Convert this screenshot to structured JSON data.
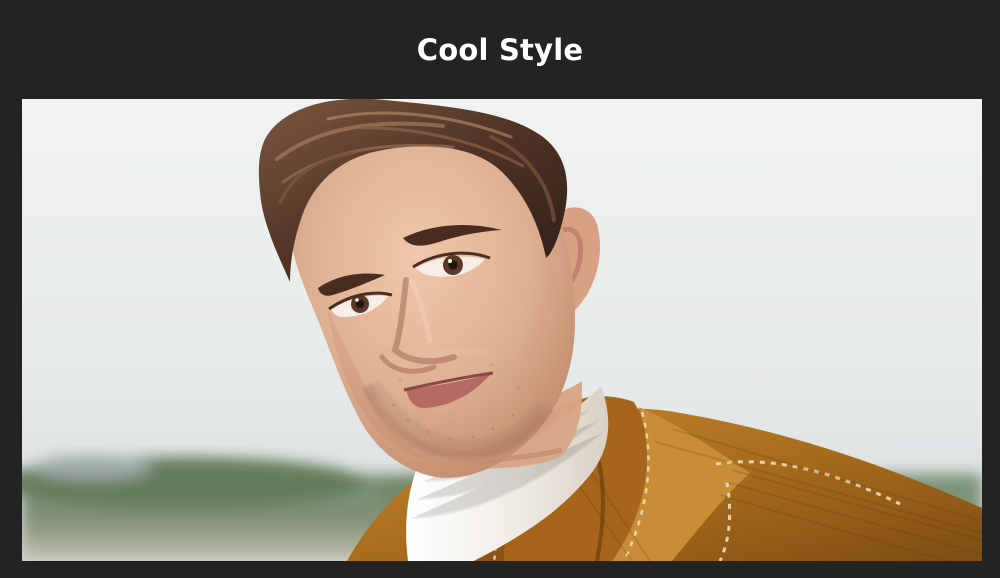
{
  "page": {
    "title": "Cool Style",
    "background_color": "#232323",
    "title_color": "#ffffff"
  },
  "photo": {
    "subject": "portrait-photo",
    "palette": {
      "sky": "#e9ecec",
      "sky_shadow": "#d7dcdd",
      "horizon_green": "#667a5a",
      "ground": "#b7bba7",
      "skin": "#e2b79a",
      "skin_shadow": "#c68f72",
      "hair": "#5a3b2a",
      "hair_highlight": "#8a634a",
      "sweater": "#ece8df",
      "jacket": "#b3761f",
      "jacket_shadow": "#8d5714",
      "stitch": "#f2d7b3"
    }
  }
}
